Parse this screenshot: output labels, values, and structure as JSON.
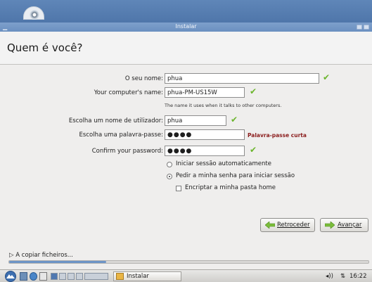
{
  "window": {
    "title": "Instalar"
  },
  "page": {
    "title": "Quem é você?"
  },
  "form": {
    "name": {
      "label": "O seu nome:",
      "value": "phua"
    },
    "computer": {
      "label": "Your computer's name:",
      "value": "phua-PM-US15W",
      "hint": "The name it uses when it talks to other computers."
    },
    "username": {
      "label": "Escolha um nome de utilizador:",
      "value": "phua"
    },
    "password": {
      "label": "Escolha uma palavra-passe:",
      "value": "●●●●",
      "warning": "Palavra-passe curta"
    },
    "confirm": {
      "label": "Confirm your password:",
      "value": "●●●●"
    }
  },
  "login_options": [
    {
      "label": "Iniciar sessão automaticamente",
      "selected": false
    },
    {
      "label": "Pedir a minha senha para iniciar sessão",
      "selected": true
    }
  ],
  "encrypt": {
    "label": "Encriptar a minha pasta home",
    "checked": false
  },
  "buttons": {
    "back": "Retroceder",
    "next": "Avançar"
  },
  "progress": {
    "label": "A copiar ficheiros...",
    "fraction": 0.27
  },
  "taskbar": {
    "task_label": "Instalar",
    "clock": "16:22"
  },
  "icons": {
    "valid": "check-icon",
    "back": "arrow-left-icon",
    "next": "arrow-right-icon",
    "expander": "triangle-right-icon",
    "volume": "speaker-icon",
    "network": "network-icon"
  },
  "colors": {
    "accent": "#6e95c6",
    "valid": "#6bb52c",
    "warning": "#8b1d1d"
  }
}
